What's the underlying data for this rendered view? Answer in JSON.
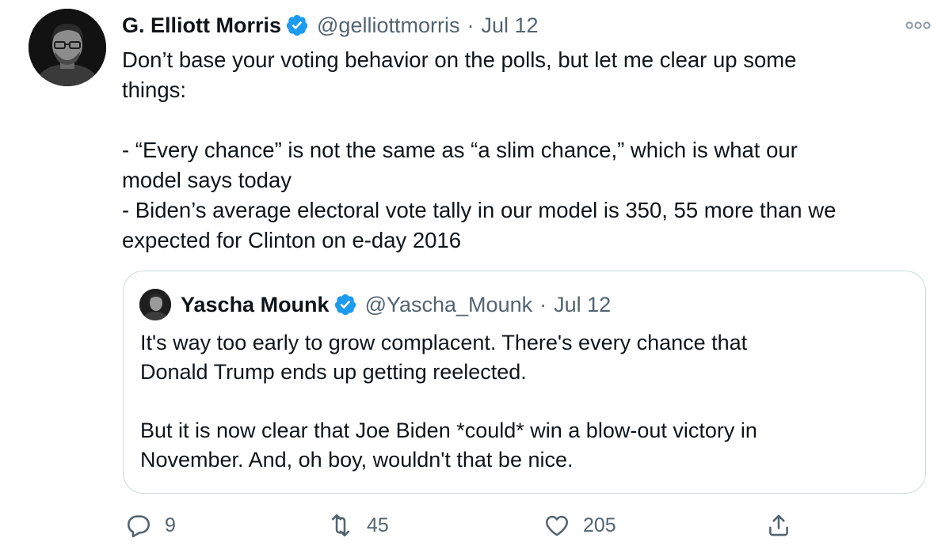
{
  "tweet": {
    "author": {
      "name": "G. Elliott Morris",
      "handle": "@gelliottmorris",
      "verified": true
    },
    "separator": "·",
    "date": "Jul 12",
    "more_icon": "more-icon",
    "text_lines": [
      "Don’t base your voting behavior on the polls, but let me clear up some",
      "things:",
      "",
      "- “Every chance” is not the same as “a slim chance,” which is what our",
      "model says today",
      "- Biden’s average electoral vote tally in our model is 350, 55 more than we",
      "expected for Clinton on e-day 2016"
    ],
    "quoted": {
      "author": {
        "name": "Yascha Mounk",
        "handle": "@Yascha_Mounk",
        "verified": true
      },
      "separator": "·",
      "date": "Jul 12",
      "text_lines": [
        "It's way too early to grow complacent. There's every chance that",
        "Donald Trump ends up getting reelected.",
        "",
        "But it is now clear that Joe Biden *could* win a blow-out victory in",
        "November. And, oh boy, wouldn't that be nice."
      ]
    },
    "actions": {
      "reply": {
        "icon": "reply-icon",
        "count": "9"
      },
      "retweet": {
        "icon": "retweet-icon",
        "count": "45"
      },
      "like": {
        "icon": "like-icon",
        "count": "205"
      },
      "share": {
        "icon": "share-icon"
      }
    }
  },
  "colors": {
    "text": "#0f1419",
    "secondary": "#536471",
    "verified": "#1d9bf0",
    "border": "#cfd9de"
  }
}
